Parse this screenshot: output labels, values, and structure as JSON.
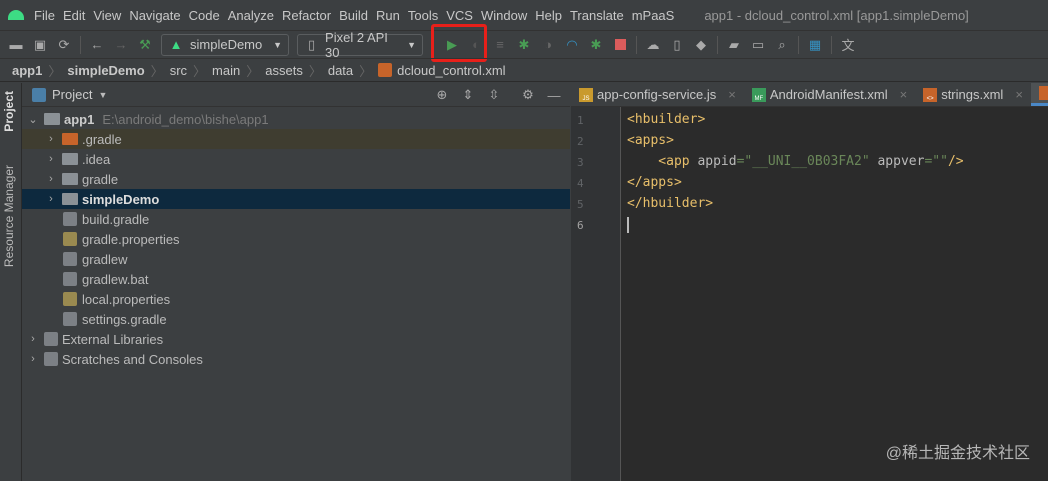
{
  "menu": {
    "items": [
      "File",
      "Edit",
      "View",
      "Navigate",
      "Code",
      "Analyze",
      "Refactor",
      "Build",
      "Run",
      "Tools",
      "VCS",
      "Window",
      "Help",
      "Translate",
      "mPaaS"
    ],
    "window_title": "app1 - dcloud_control.xml [app1.simpleDemo]"
  },
  "toolbar": {
    "config": "simpleDemo",
    "device": "Pixel 2 API 30"
  },
  "breadcrumb": [
    "app1",
    "simpleDemo",
    "src",
    "main",
    "assets",
    "data",
    "dcloud_control.xml"
  ],
  "sidebar": {
    "tabs": [
      "Project",
      "Resource Manager"
    ]
  },
  "project": {
    "title": "Project",
    "root": {
      "name": "app1",
      "path": "E:\\android_demo\\bishe\\app1"
    },
    "items": [
      {
        "name": ".gradle",
        "type": "folder-excluded"
      },
      {
        "name": ".idea",
        "type": "folder"
      },
      {
        "name": "gradle",
        "type": "folder"
      },
      {
        "name": "simpleDemo",
        "type": "module"
      },
      {
        "name": "build.gradle",
        "type": "gradle"
      },
      {
        "name": "gradle.properties",
        "type": "properties"
      },
      {
        "name": "gradlew",
        "type": "script"
      },
      {
        "name": "gradlew.bat",
        "type": "file"
      },
      {
        "name": "local.properties",
        "type": "properties"
      },
      {
        "name": "settings.gradle",
        "type": "gradle"
      }
    ],
    "external": "External Libraries",
    "scratches": "Scratches and Consoles"
  },
  "editor": {
    "tabs": [
      {
        "label": "app-config-service.js",
        "badge": "JS",
        "color": "#c99a2e"
      },
      {
        "label": "AndroidManifest.xml",
        "badge": "MF",
        "color": "#3a9a5b"
      },
      {
        "label": "strings.xml",
        "badge": "<>",
        "color": "#c7642a"
      }
    ],
    "line_numbers": [
      "1",
      "2",
      "3",
      "4",
      "5",
      "6"
    ],
    "lines": {
      "l1": "<hbuilder>",
      "l2": "<apps>",
      "l3_tag": "    <app ",
      "l3_a1": "appid",
      "l3_eq1": "=",
      "l3_v1": "\"__UNI__0B03FA2\"",
      "l3_a2": " appver",
      "l3_eq2": "=",
      "l3_v2": "\"\"",
      "l3_end": "/>",
      "l4": "</apps>",
      "l5": "</hbuilder>"
    }
  },
  "watermark": "@稀土掘金技术社区",
  "colors": {
    "accent": "#4a88c7",
    "run": "#499c54",
    "highlight_box": "#e8201a"
  }
}
